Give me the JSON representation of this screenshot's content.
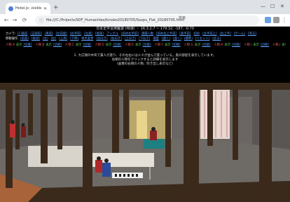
{
  "browser": {
    "tab_title": "Hotel.js: visible - Kojiden - GBG ...",
    "url": "file:///C:/Projects/SDF_Humanities/kinobo20180705/Sozpu_Flat_20180705.html",
    "search_placeholder": "検索"
  },
  "page": {
    "title": "日本史学習用鑑賞 (特選)  ・ 16.3.2.7 ~ 179.32, -187, -0.70 ",
    "row1": {
      "label": "カメラ:",
      "links": [
        "[1]面前",
        "[正面前]",
        "[奥部]",
        "[左前面]",
        "[右手前]",
        "[左奥]",
        "[後部]",
        "アングル",
        "[斜め左手前]",
        "遠隔人数",
        "[斜め右上手前]",
        "[奥手前]",
        "斜め",
        "[左手前上]",
        "[右上手]",
        "[ゲーム]",
        "[見方]"
      ]
    },
    "row2": {
      "label": "移動操作:",
      "links": [
        "[前進]",
        "[後退]",
        "[左]",
        "[右]",
        "[上昇]",
        "[下降]",
        "視点変更",
        "[左向き]",
        "[右向き]",
        "[上向き]",
        "[下向き]",
        "速度",
        "[遅く]",
        "[速く]",
        "[標準]",
        "[リセット]",
        "[戻る]"
      ]
    },
    "row3": {
      "items": [
        {
          "a": "人物 A",
          "b": "表示",
          "c": "[切替]"
        },
        {
          "a": "人物 B",
          "b": "表示",
          "c": "[切替]"
        },
        {
          "a": "人物 C",
          "b": "表示",
          "c": "[切替]"
        },
        {
          "a": "人物 D",
          "b": "表示",
          "c": "[切替]"
        },
        {
          "a": "人物 E",
          "b": "表示",
          "c": "[切替]"
        },
        {
          "a": "人物 F",
          "b": "表示",
          "c": "[切替]"
        },
        {
          "a": "人物 G",
          "b": "表示",
          "c": "[切替]"
        },
        {
          "a": "人物 H",
          "b": "表示",
          "c": "[切替]"
        },
        {
          "a": "人物 I",
          "b": "表示",
          "c": "[切替]"
        },
        {
          "a": "人物 J",
          "b": "表示",
          "c": "[切替]"
        }
      ]
    },
    "note1": "1.",
    "note2": "2. 大広間の中央で貴人が座り、その左右には人々が並んで座っている。奥の部屋を表示しています。",
    "note3": "右側の人物をクリックすると詳細を表示します",
    "note4": "(画像の右側の人物、吹き出し表示など)"
  }
}
